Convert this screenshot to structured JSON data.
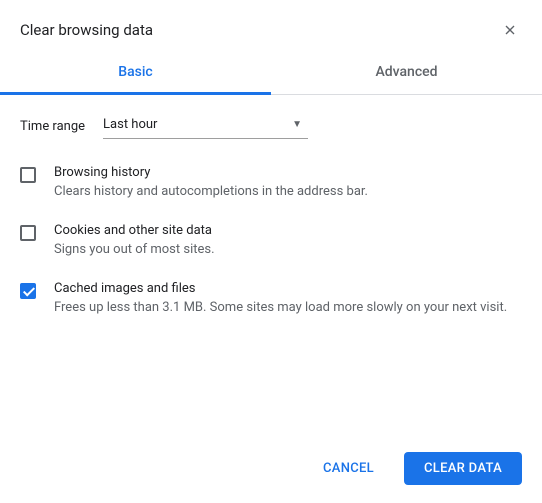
{
  "dialog": {
    "title": "Clear browsing data"
  },
  "tabs": {
    "basic": "Basic",
    "advanced": "Advanced"
  },
  "timeRange": {
    "label": "Time range",
    "value": "Last hour"
  },
  "items": [
    {
      "title": "Browsing history",
      "desc": "Clears history and autocompletions in the address bar.",
      "checked": false
    },
    {
      "title": "Cookies and other site data",
      "desc": "Signs you out of most sites.",
      "checked": false
    },
    {
      "title": "Cached images and files",
      "desc": "Frees up less than 3.1 MB. Some sites may load more slowly on your next visit.",
      "checked": true
    }
  ],
  "buttons": {
    "cancel": "CANCEL",
    "clear": "CLEAR DATA"
  }
}
